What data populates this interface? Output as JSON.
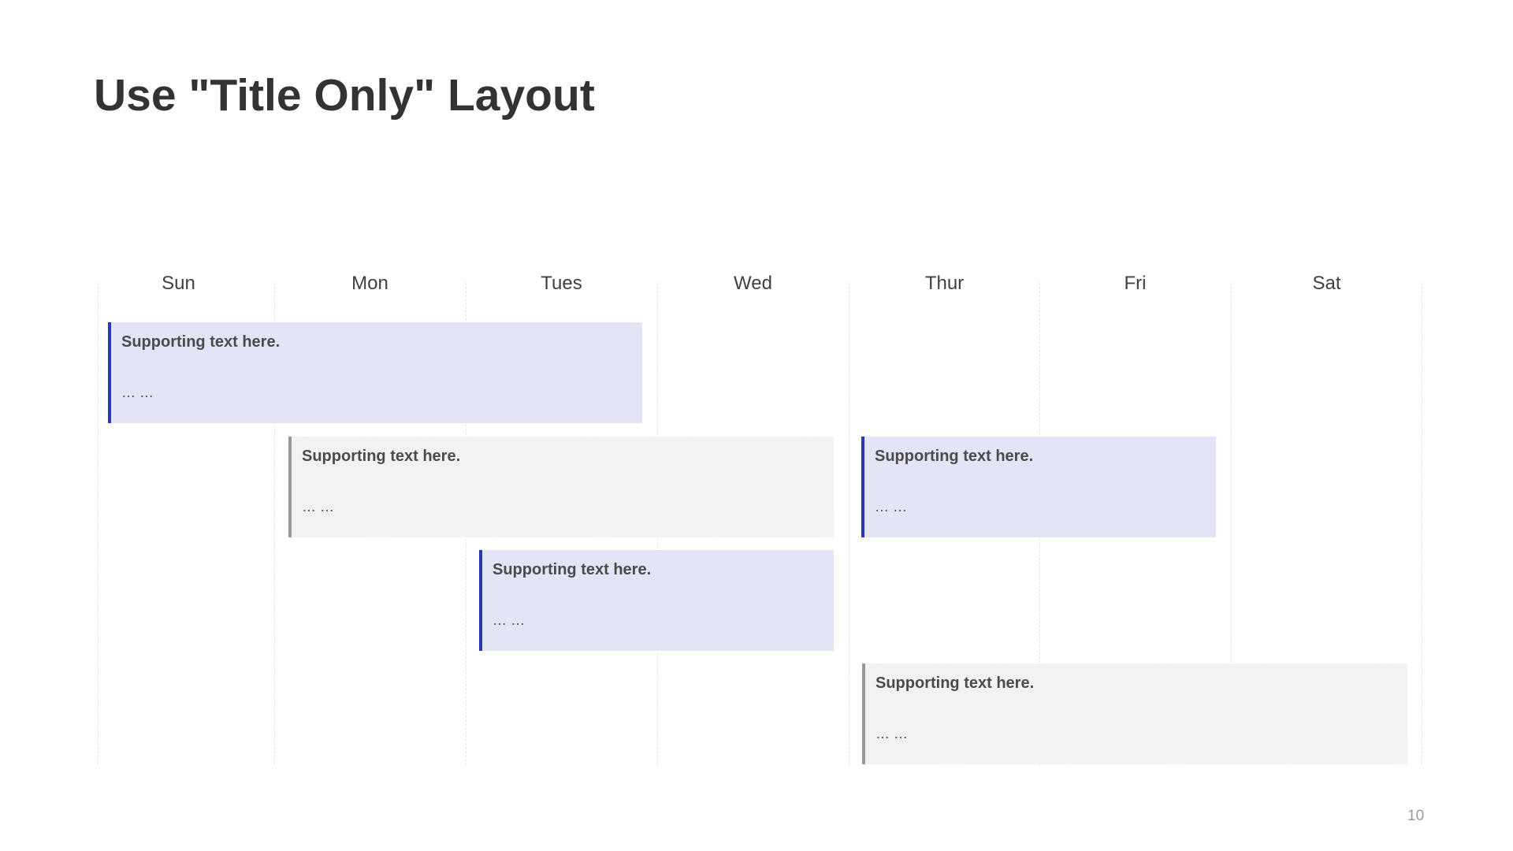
{
  "slide": {
    "title": "Use \"Title Only\" Layout",
    "page_number": "10"
  },
  "calendar": {
    "days": [
      "Sun",
      "Mon",
      "Tues",
      "Wed",
      "Thur",
      "Fri",
      "Sat"
    ],
    "events": [
      {
        "title": "Supporting text here.",
        "detail": "… …",
        "start_day": "Sun",
        "end_day": "Tues",
        "style": "blue",
        "accent": "#2b35b8",
        "fill": "#e3e4f6"
      },
      {
        "title": "Supporting text here.",
        "detail": "… …",
        "start_day": "Mon",
        "end_day": "Wed",
        "style": "gray",
        "accent": "#999999",
        "fill": "#f3f3f3"
      },
      {
        "title": "Supporting text here.",
        "detail": "… …",
        "start_day": "Thur",
        "end_day": "Fri",
        "style": "blue",
        "accent": "#2b35b8",
        "fill": "#e3e4f6"
      },
      {
        "title": "Supporting text here.",
        "detail": "… …",
        "start_day": "Tues",
        "end_day": "Wed",
        "style": "blue",
        "accent": "#2b35b8",
        "fill": "#e3e4f6"
      },
      {
        "title": "Supporting text here.",
        "detail": "… …",
        "start_day": "Thur",
        "end_day": "Sat",
        "style": "gray",
        "accent": "#999999",
        "fill": "#f3f3f3"
      }
    ]
  }
}
